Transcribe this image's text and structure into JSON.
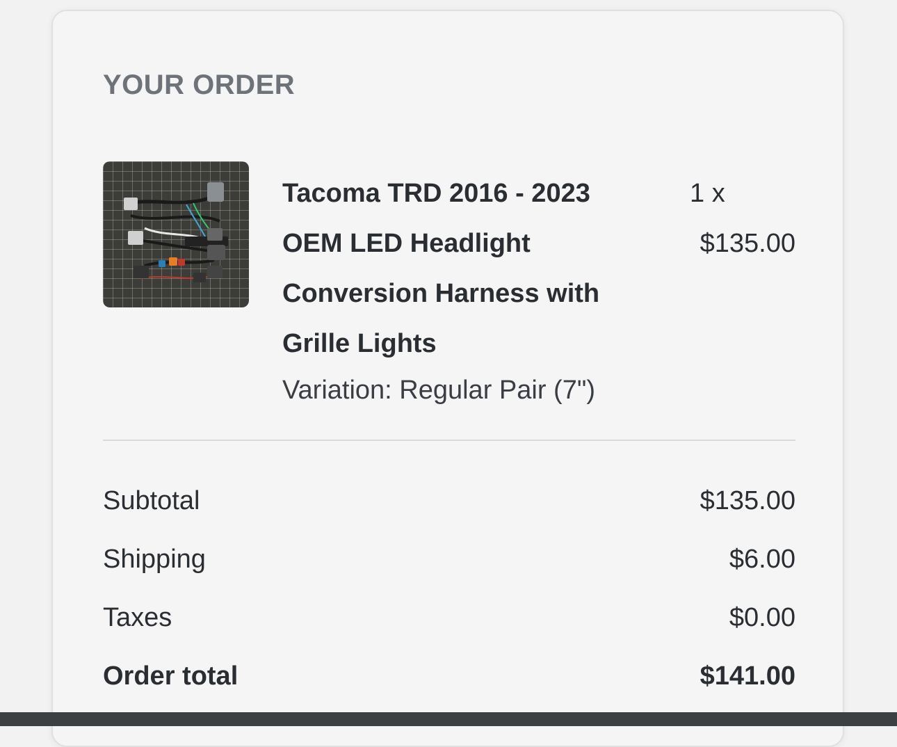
{
  "order": {
    "heading": "YOUR ORDER",
    "item": {
      "name_lines": [
        "Tacoma TRD 2016 - 2023",
        "OEM LED Headlight",
        "Conversion Harness with",
        "Grille Lights"
      ],
      "variation": "Variation: Regular Pair (7\")",
      "quantity": "1 x",
      "price": "$135.00",
      "image_icon": "product-photo-wiring-harness"
    },
    "summary": [
      {
        "label": "Subtotal",
        "value": "$135.00"
      },
      {
        "label": "Shipping",
        "value": "$6.00"
      },
      {
        "label": "Taxes",
        "value": "$0.00"
      }
    ],
    "total": {
      "label": "Order total",
      "value": "$141.00"
    }
  },
  "colors": {
    "background": "#f2f2f2",
    "card": "#f5f5f5",
    "heading": "#6e7279",
    "text": "#2a2e33",
    "divider": "#d6d9dd",
    "bottom_bar": "#3d4043"
  }
}
